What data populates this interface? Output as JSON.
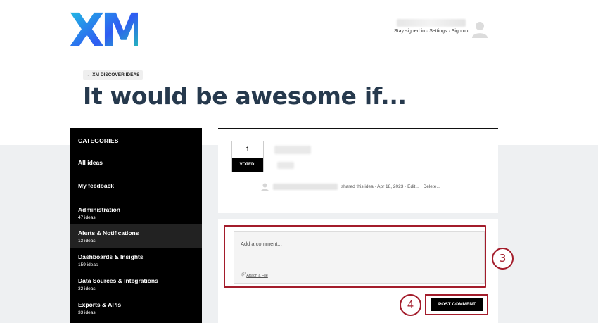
{
  "brand": {
    "logo_text": "XM",
    "colors": {
      "accent": "#a31c2b",
      "sidebar_bg": "#000000",
      "title": "#26394d",
      "logo_gradient": [
        "#1ec8e0",
        "#2f5cf2",
        "#20d8a8"
      ]
    }
  },
  "header": {
    "links": [
      "Stay signed in",
      "Settings",
      "Sign out"
    ]
  },
  "back_link": "← XM DISCOVER IDEAS",
  "page_title": "It would be awesome if...",
  "sidebar": {
    "title": "CATEGORIES",
    "items": [
      {
        "label": "All ideas",
        "count": ""
      },
      {
        "label": "My feedback",
        "count": ""
      },
      {
        "label": "Administration",
        "count": "47 ideas"
      },
      {
        "label": "Alerts & Notifications",
        "count": "13 ideas"
      },
      {
        "label": "Dashboards & Insights",
        "count": "159 ideas"
      },
      {
        "label": "Data Sources & Integrations",
        "count": "32 ideas"
      },
      {
        "label": "Exports & APIs",
        "count": "33 ideas"
      }
    ]
  },
  "idea": {
    "vote_count": "1",
    "vote_status": "VOTED!",
    "shared_text": "shared this idea",
    "date": "Apr 18, 2023",
    "edit_link": "Edit...",
    "delete_link": "Delete..."
  },
  "comment": {
    "placeholder": "Add a comment...",
    "attach_label": "Attach a File",
    "post_button": "POST COMMENT"
  },
  "callouts": {
    "step_a": "3",
    "step_b": "4"
  }
}
